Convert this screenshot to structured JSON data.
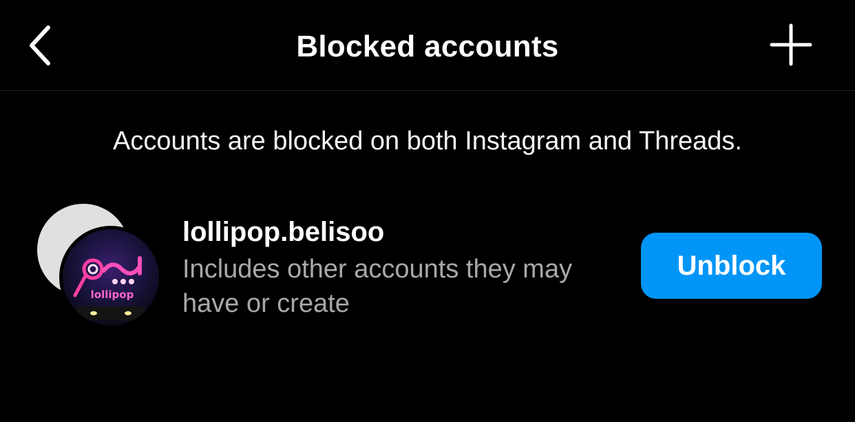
{
  "header": {
    "title": "Blocked accounts",
    "back_icon": "chevron-left-icon",
    "add_icon": "plus-icon"
  },
  "info": {
    "text": "Accounts are blocked on both Instagram and Threads."
  },
  "blocked_accounts": [
    {
      "username": "lollipop.belisoo",
      "description": "Includes other accounts they may have or create",
      "action_label": "Unblock",
      "avatar_logo_text": "lollipop"
    }
  ],
  "colors": {
    "background": "#000000",
    "primary_button": "#0095f6",
    "secondary_text": "#a8a8a8",
    "divider": "#262626"
  }
}
